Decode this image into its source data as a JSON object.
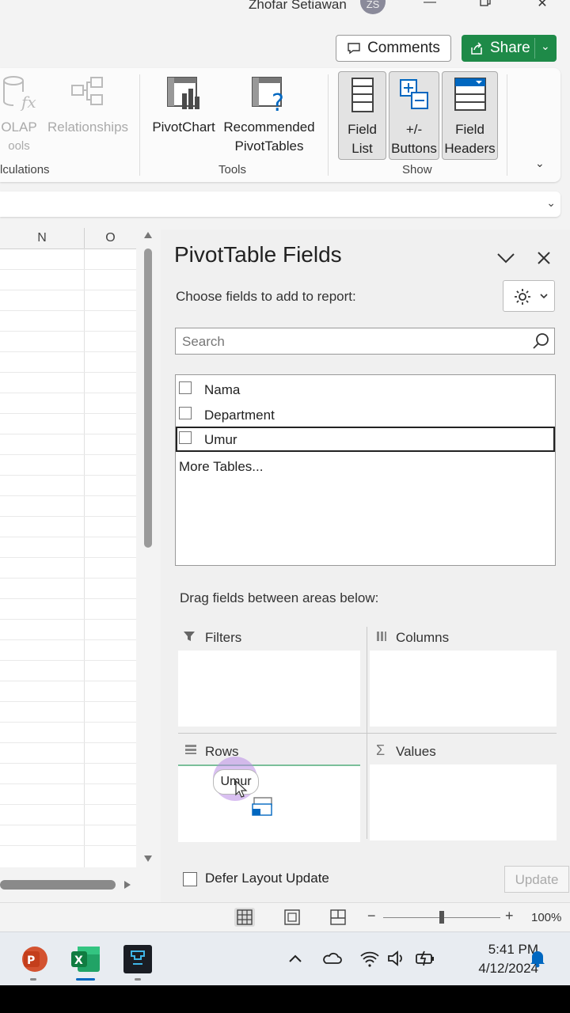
{
  "titlebar": {
    "user_name": "Zhofar Setiawan",
    "avatar_initials": "ZS"
  },
  "actions": {
    "comments_label": "Comments",
    "share_label": "Share"
  },
  "ribbon": {
    "olap_label": "OLAP",
    "olap_label2": "ools",
    "relationships_label": "Relationships",
    "calculations_group": "lculations",
    "pivotchart_label": "PivotChart",
    "recommended_label1": "Recommended",
    "recommended_label2": "PivotTables",
    "tools_group": "Tools",
    "field_list_label1": "Field",
    "field_list_label2": "List",
    "buttons_label1": "+/-",
    "buttons_label2": "Buttons",
    "field_headers_label1": "Field",
    "field_headers_label2": "Headers",
    "show_group": "Show"
  },
  "sheet": {
    "columns": [
      "N",
      "O"
    ]
  },
  "pivot_pane": {
    "title": "PivotTable Fields",
    "subtitle": "Choose fields to add to report:",
    "search_placeholder": "Search",
    "fields": [
      {
        "label": "Nama",
        "checked": false
      },
      {
        "label": "Department",
        "checked": false
      },
      {
        "label": "Umur",
        "checked": false
      }
    ],
    "more_tables": "More Tables...",
    "drag_instruction": "Drag fields between areas below:",
    "areas": {
      "filters": "Filters",
      "columns": "Columns",
      "rows": "Rows",
      "values": "Values"
    },
    "dragging_field": "Umur",
    "defer_label": "Defer Layout Update",
    "update_label": "Update"
  },
  "statusbar": {
    "zoom": "100%"
  },
  "taskbar": {
    "time": "5:41 PM",
    "date": "4/12/2024"
  },
  "colors": {
    "share_green": "#1e8a48",
    "excel_green": "#107c41",
    "accent_blue": "#0067c0"
  }
}
